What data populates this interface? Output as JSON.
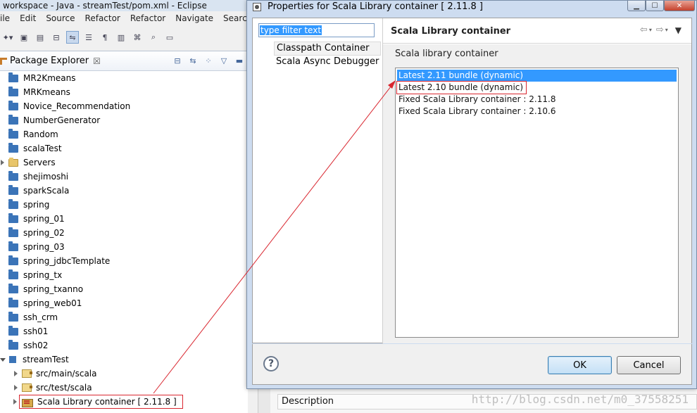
{
  "eclipse": {
    "window_title": "workspace - Java - streamTest/pom.xml - Eclipse",
    "menu": [
      "ile",
      "Edit",
      "Source",
      "Refactor",
      "Refactor",
      "Navigate",
      "Search"
    ],
    "toolbar_icons": [
      "new-icon",
      "save-icon",
      "save-all-icon",
      "binary-icon",
      "link-editor-icon",
      "toggle-breadcrumb-icon",
      "show-whitespace-icon",
      "properties-icon",
      "mark-occurrences-icon",
      "search-icon",
      "console-icon"
    ],
    "package_explorer": {
      "tab_label": "Package Explorer",
      "tab_close": "☒",
      "projects": [
        {
          "label": "MR2Kmeans",
          "type": "folder",
          "twisty": false
        },
        {
          "label": "MRKmeans",
          "type": "folder",
          "twisty": false
        },
        {
          "label": "Novice_Recommendation",
          "type": "folder",
          "twisty": false
        },
        {
          "label": "NumberGenerator",
          "type": "folder",
          "twisty": false
        },
        {
          "label": "Random",
          "type": "folder",
          "twisty": false
        },
        {
          "label": "scalaTest",
          "type": "folder",
          "twisty": false
        },
        {
          "label": "Servers",
          "type": "open-folder",
          "twisty": true
        },
        {
          "label": "shejimoshi",
          "type": "folder",
          "twisty": false
        },
        {
          "label": "sparkScala",
          "type": "folder",
          "twisty": false
        },
        {
          "label": "spring",
          "type": "folder",
          "twisty": false
        },
        {
          "label": "spring_01",
          "type": "folder",
          "twisty": false
        },
        {
          "label": "spring_02",
          "type": "folder",
          "twisty": false
        },
        {
          "label": "spring_03",
          "type": "folder",
          "twisty": false
        },
        {
          "label": "spring_jdbcTemplate",
          "type": "folder",
          "twisty": false
        },
        {
          "label": "spring_tx",
          "type": "folder",
          "twisty": false
        },
        {
          "label": "spring_txanno",
          "type": "folder",
          "twisty": false
        },
        {
          "label": "spring_web01",
          "type": "folder",
          "twisty": false
        },
        {
          "label": "ssh_crm",
          "type": "folder",
          "twisty": false
        },
        {
          "label": "ssh01",
          "type": "folder",
          "twisty": false
        },
        {
          "label": "ssh02",
          "type": "folder",
          "twisty": false
        }
      ],
      "stream_test": {
        "label": "streamTest",
        "children": [
          "src/main/scala",
          "src/test/scala"
        ],
        "library": "Scala Library container [ 2.11.8 ]"
      }
    },
    "bottom_panel": {
      "description_header": "Description"
    }
  },
  "dialog": {
    "title": "Properties for Scala Library container [ 2.11.8 ]",
    "window_buttons": {
      "minimize": "▁",
      "maximize": "☐",
      "close": "✕"
    },
    "filter_placeholder": "type filter text",
    "nav_items": [
      "Classpath Container",
      "Scala Async Debugger"
    ],
    "page_title": "Scala Library container",
    "page_nav": {
      "back": "⇦",
      "forward": "⇨",
      "dropdown": "▾",
      "menu": "▼"
    },
    "content_label": "Scala library container",
    "bundles": [
      "Latest 2.11 bundle (dynamic)",
      "Latest 2.10 bundle (dynamic)",
      "Fixed Scala Library container : 2.11.8",
      "Fixed Scala Library container : 2.10.6"
    ],
    "selected_bundle_index": 0,
    "annotated_bundle_index": 1,
    "buttons": {
      "help": "?",
      "ok": "OK",
      "cancel": "Cancel"
    }
  },
  "watermark": "http://blog.csdn.net/m0_37558251",
  "colors": {
    "selection": "#3399ff",
    "annotation": "#d9262f",
    "folder": "#3b74b8",
    "dialog_frame": "#cddcf0"
  }
}
